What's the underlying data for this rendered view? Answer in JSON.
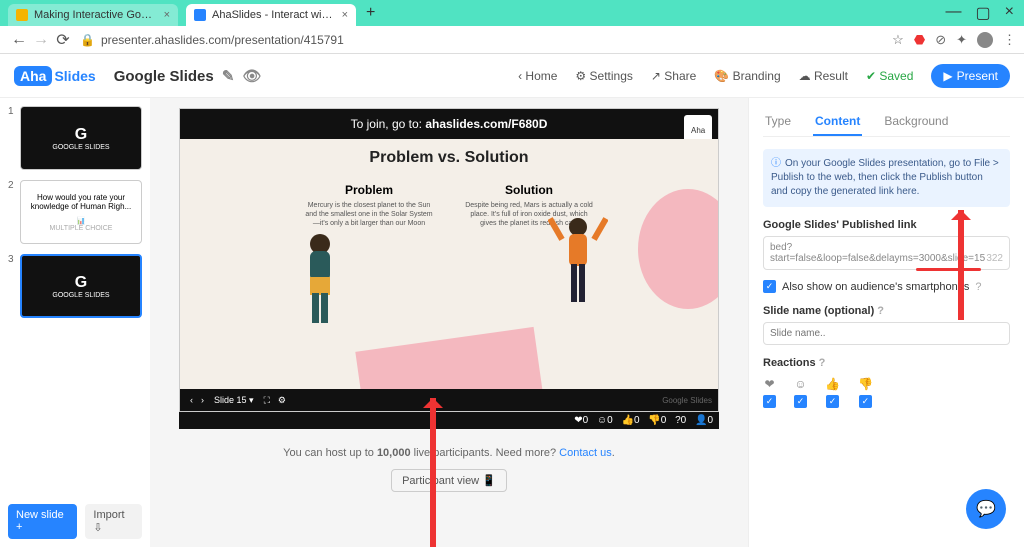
{
  "browser": {
    "tabs": [
      {
        "label": "Making Interactive Google Slides"
      },
      {
        "label": "AhaSlides - Interact with your au"
      }
    ],
    "url": "presenter.ahaslides.com/presentation/415791"
  },
  "header": {
    "logo_a": "Aha",
    "logo_b": "Slides",
    "title": "Google Slides",
    "nav": {
      "home": "Home",
      "settings": "Settings",
      "share": "Share",
      "branding": "Branding",
      "result": "Result",
      "saved": "Saved",
      "present": "Present"
    }
  },
  "sidebar": {
    "thumbs": [
      {
        "num": "1",
        "type": "dark",
        "line1": "G",
        "line2": "GOOGLE SLIDES"
      },
      {
        "num": "2",
        "type": "light",
        "line1": "How would you rate your knowledge of Human Righ...",
        "line2": "MULTIPLE CHOICE"
      },
      {
        "num": "3",
        "type": "dark",
        "line1": "G",
        "line2": "GOOGLE SLIDES"
      }
    ],
    "new_slide": "New slide",
    "import": "Import"
  },
  "slide": {
    "join_prefix": "To join, go to: ",
    "join_url": "ahaslides.com/F680D",
    "title": "Problem vs. Solution",
    "card1_h": "Problem",
    "card1_p": "Mercury is the closest planet to the Sun and the smallest one in the Solar System—it's only a bit larger than our Moon",
    "card2_h": "Solution",
    "card2_p": "Despite being red, Mars is actually a cold place. It's full of iron oxide dust, which gives the planet its reddish cast",
    "footer_slide": "Slide 15",
    "brand": "Google Slides",
    "reacts": {
      "heart": "0",
      "smile": "0",
      "thumb": "0",
      "down": "0",
      "q": "0",
      "people": "0"
    }
  },
  "below": {
    "text1": "You can host up to ",
    "text_bold": "10,000",
    "text2": " live participants. Need more? ",
    "link": "Contact us",
    "pv": "Participant view"
  },
  "panel": {
    "tabs": {
      "type": "Type",
      "content": "Content",
      "background": "Background"
    },
    "info": "On your Google Slides presentation, go to File > Publish to the web, then click the Publish button and copy the generated link here.",
    "link_label": "Google Slides' Published link",
    "link_value": "bed?start=false&loop=false&delayms=3000&slide=15",
    "link_count": "322",
    "also_show": "Also show on audience's smartphones",
    "slide_name_label": "Slide name (optional)",
    "slide_name_placeholder": "Slide name..",
    "reactions_label": "Reactions"
  }
}
